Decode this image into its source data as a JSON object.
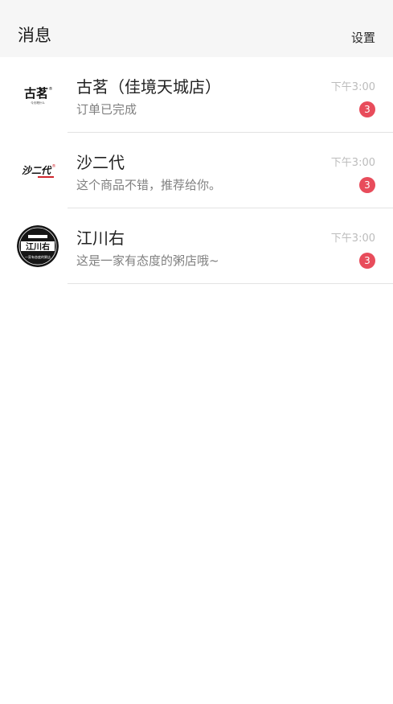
{
  "header": {
    "title": "消息",
    "settings_label": "设置"
  },
  "conversations": [
    {
      "name": "古茗（佳境天城店）",
      "preview": "订单已完成",
      "time": "下午3:00",
      "unread": "3",
      "logo_text": "古茗",
      "logo_subtext": "今天喝什么",
      "logo_mark": "®"
    },
    {
      "name": "沙二代",
      "preview": "这个商品不错，推荐给你。",
      "time": "下午3:00",
      "unread": "3",
      "logo_text": "沙二代",
      "logo_mark": "®"
    },
    {
      "name": "江川右",
      "preview": "这是一家有态度的粥店哦~",
      "time": "下午3:00",
      "unread": "3",
      "logo_text": "江川右",
      "logo_subtext": "一家有态度的粥店"
    }
  ],
  "colors": {
    "header_bg": "#f6f6f6",
    "badge": "#e84c5b",
    "time": "#bcbcbc",
    "preview": "#808080",
    "divider": "#e3e3e3"
  }
}
